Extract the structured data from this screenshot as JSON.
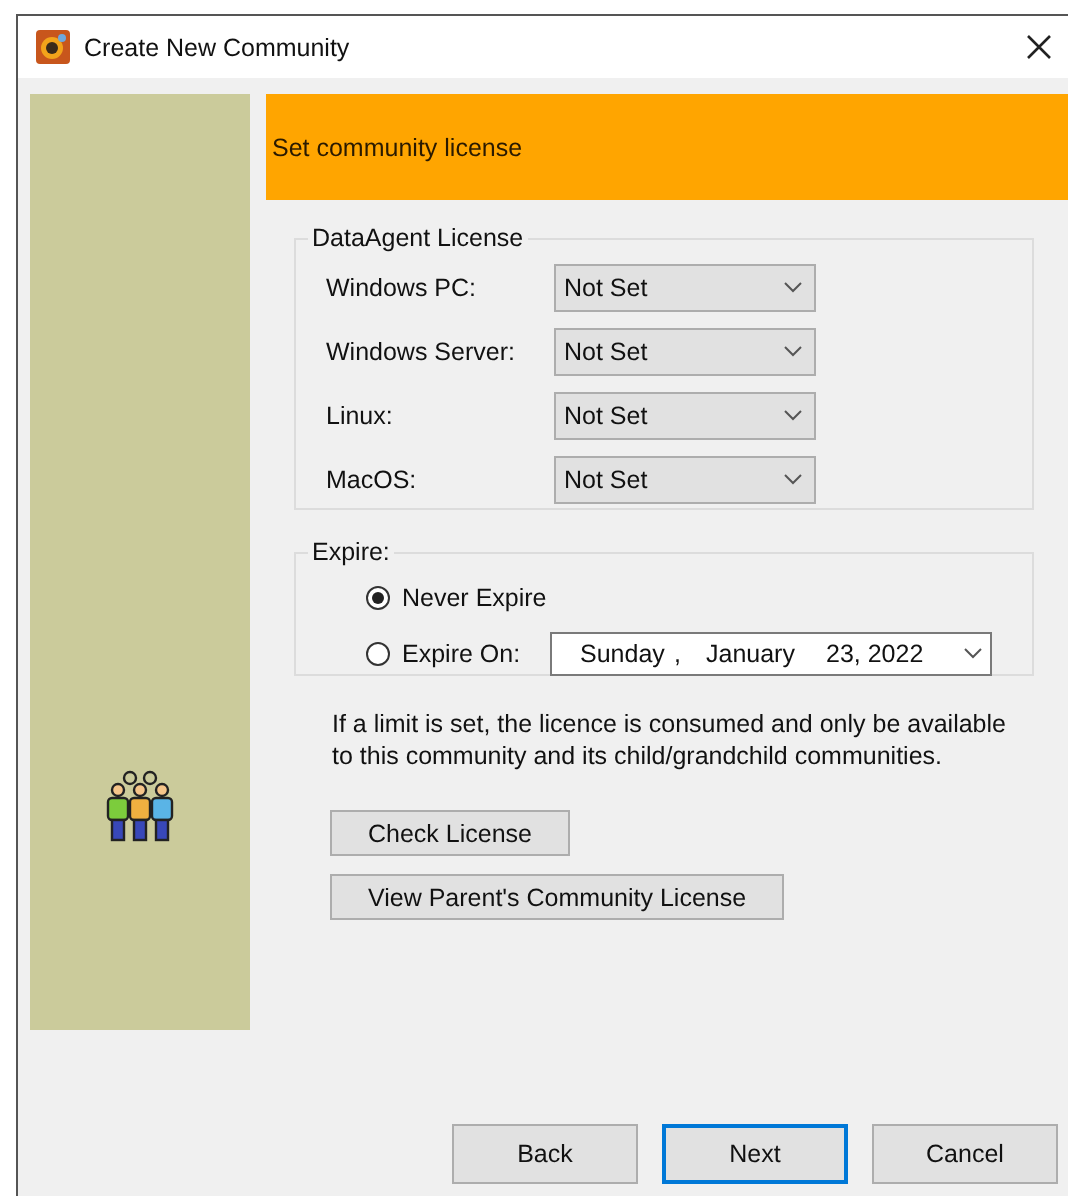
{
  "window": {
    "title": "Create New Community"
  },
  "header": "Set community license",
  "license_group": {
    "title": "DataAgent License",
    "rows": [
      {
        "label": "Windows PC:",
        "value": "Not Set"
      },
      {
        "label": "Windows Server:",
        "value": "Not Set"
      },
      {
        "label": "Linux:",
        "value": "Not Set"
      },
      {
        "label": "MacOS:",
        "value": "Not Set"
      }
    ]
  },
  "expire_group": {
    "title": "Expire:",
    "options": [
      {
        "label": "Never Expire",
        "selected": true
      },
      {
        "label": "Expire On:",
        "selected": false
      }
    ],
    "date": {
      "weekday": "Sunday",
      "separator": ",",
      "month": "January",
      "day_year": "23, 2022"
    }
  },
  "note": "If a limit is set, the licence is consumed and only be available to this community and its child/grandchild communities.",
  "actions": [
    "Check License",
    "View Parent's Community License"
  ],
  "nav_buttons": [
    {
      "label": "Back",
      "default": false
    },
    {
      "label": "Next",
      "default": true
    },
    {
      "label": "Cancel",
      "default": false
    }
  ]
}
